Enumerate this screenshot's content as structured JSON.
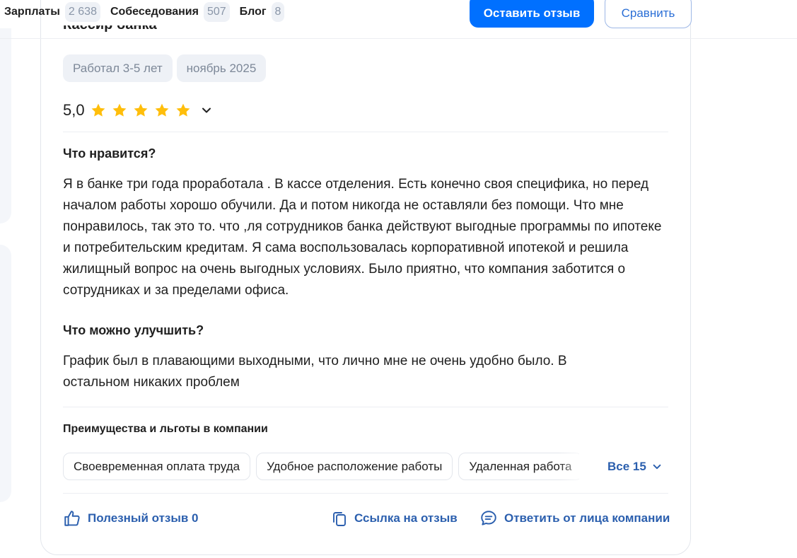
{
  "nav": {
    "tabs": [
      {
        "label": "Зарплаты",
        "count": "2 638"
      },
      {
        "label": "Собеседования",
        "count": "507"
      },
      {
        "label": "Блог",
        "count": "8"
      }
    ],
    "leave_review_label": "Оставить отзыв",
    "compare_label": "Сравнить"
  },
  "review": {
    "job_title": "Кассир банка",
    "tags": [
      "Работал 3-5 лет",
      "ноябрь 2025"
    ],
    "rating": "5,0",
    "stars": 5,
    "likes_title": "Что нравится?",
    "likes_text": "Я в банке три года проработала . В кассе отделения. Есть конечно своя специфика, но перед началом работы хорошо обучили. Да и потом никогда не оставляли без помощи. Что мне понравилось, так это то. что ,ля сотрудников банка действуют выгодные программы по ипотеке и потребительским кредитам. Я сама воспользовалась корпоративной ипотекой и решила жилищный вопрос на очень выгодных условиях. Было приятно, что компания заботится о сотрудниках и за пределами офиса.",
    "improve_title": "Что можно улучшить?",
    "improve_text": "График был в плавающими выходными, что лично мне не очень удобно было. В остальном никаких проблем",
    "benefits_title": "Преимущества и льготы в компании",
    "benefits": [
      "Своевременная оплата труда",
      "Удобное расположение работы",
      "Удаленная работа"
    ],
    "all_benefits_label": "Все 15",
    "helpful_label": "Полезный отзыв 0",
    "link_label": "Ссылка на отзыв",
    "reply_label": "Ответить от лица компании"
  },
  "colors": {
    "accent": "#0070ff",
    "link": "#2b5fae",
    "star": "#ffbe0b",
    "tag_bg": "#eef1f6"
  }
}
